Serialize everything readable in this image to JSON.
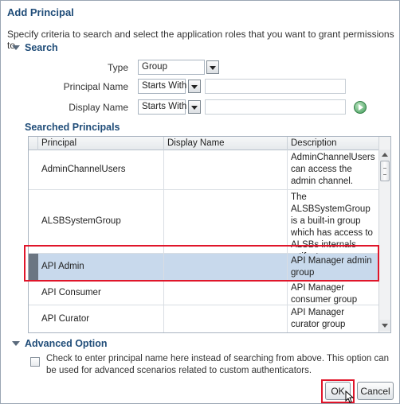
{
  "dialog": {
    "title": "Add Principal",
    "instructions": "Specify criteria to search and select the application roles that you want to grant permissions to."
  },
  "search": {
    "header": "Search",
    "type_label": "Type",
    "type_value": "Group",
    "principal_name_label": "Principal Name",
    "principal_name_operator": "Starts With",
    "principal_name_value": "",
    "display_name_label": "Display Name",
    "display_name_operator": "Starts With",
    "display_name_value": ""
  },
  "results": {
    "header": "Searched Principals",
    "columns": [
      "Principal",
      "Display Name",
      "Description"
    ],
    "rows": [
      {
        "principal": "AdminChannelUsers",
        "display_name": "",
        "description": "AdminChannelUsers can access the admin channel.",
        "selected": false
      },
      {
        "principal": "ALSBSystemGroup",
        "display_name": "",
        "description": "The ALSBSystemGroup is a built-in group which has access to ALSBs internals artifacts",
        "selected": false
      },
      {
        "principal": "API Admin",
        "display_name": "",
        "description": "API Manager admin group",
        "selected": true
      },
      {
        "principal": "API Consumer",
        "display_name": "",
        "description": "API Manager consumer group",
        "selected": false
      },
      {
        "principal": "API Curator",
        "display_name": "",
        "description": "API Manager curator group",
        "selected": false
      }
    ]
  },
  "advanced": {
    "header": "Advanced Option",
    "checkbox_label": "Check to enter principal name here instead of searching from above. This option can be used for advanced scenarios related to custom authenticators.",
    "checked": false
  },
  "buttons": {
    "ok": "OK",
    "cancel": "Cancel"
  },
  "colors": {
    "title": "#1f4c78",
    "selected_row": "#c8d9ec",
    "highlight": "#e0152a"
  }
}
